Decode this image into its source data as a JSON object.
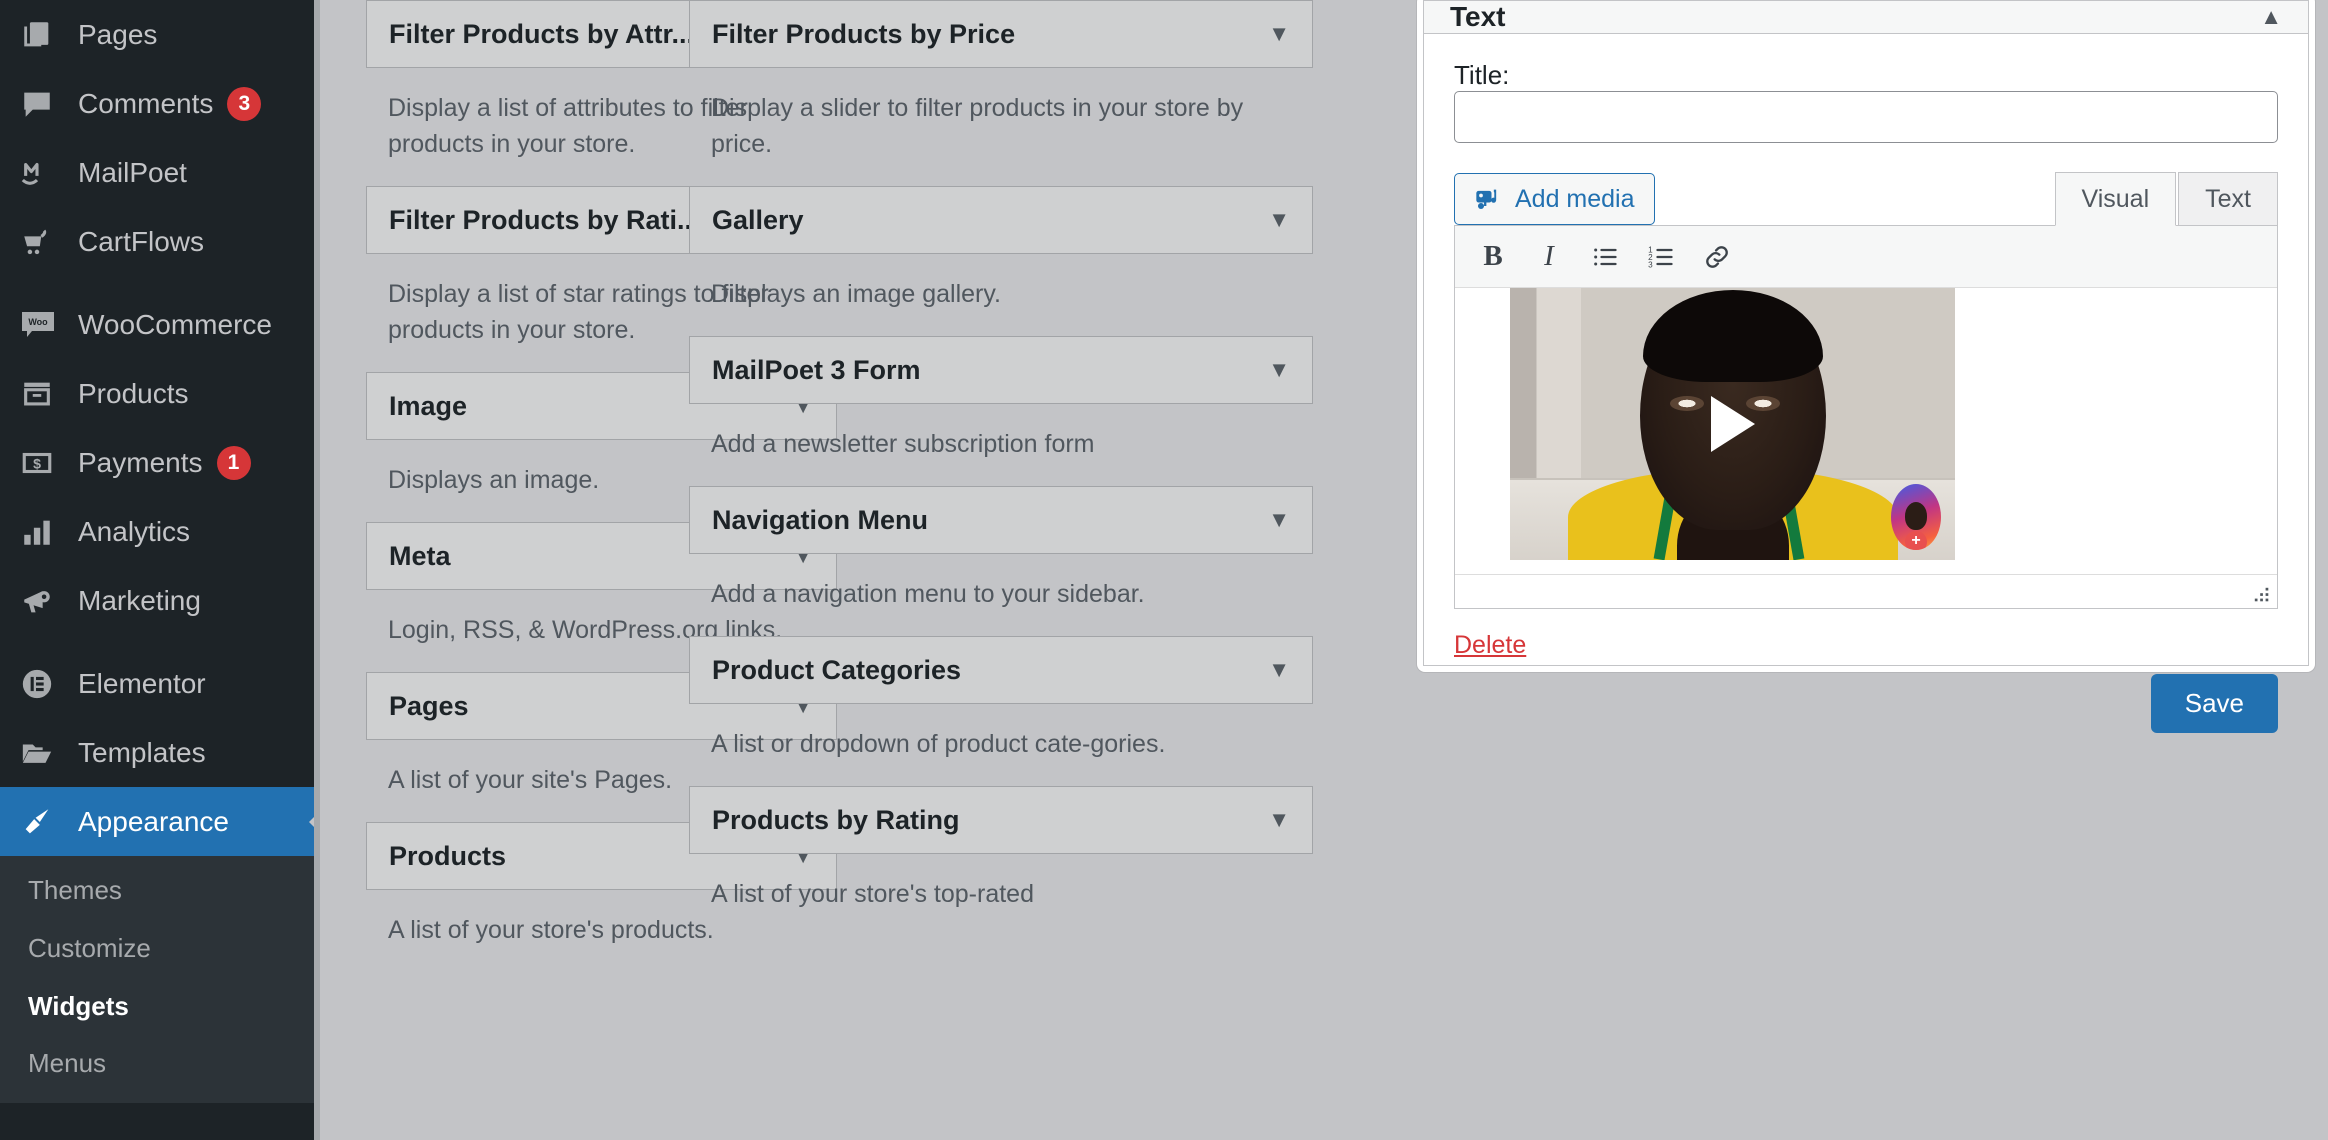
{
  "sidebar": {
    "items": [
      {
        "label": "Pages",
        "icon": "pages-icon",
        "badge": null
      },
      {
        "label": "Comments",
        "icon": "comments-icon",
        "badge": "3"
      },
      {
        "label": "MailPoet",
        "icon": "mailpoet-icon",
        "badge": null
      },
      {
        "label": "CartFlows",
        "icon": "cartflows-icon",
        "badge": null
      },
      {
        "label": "WooCommerce",
        "icon": "woocommerce-icon",
        "badge": null
      },
      {
        "label": "Products",
        "icon": "products-icon",
        "badge": null
      },
      {
        "label": "Payments",
        "icon": "payments-icon",
        "badge": "1"
      },
      {
        "label": "Analytics",
        "icon": "analytics-icon",
        "badge": null
      },
      {
        "label": "Marketing",
        "icon": "marketing-icon",
        "badge": null
      },
      {
        "label": "Elementor",
        "icon": "elementor-icon",
        "badge": null
      },
      {
        "label": "Templates",
        "icon": "templates-icon",
        "badge": null
      },
      {
        "label": "Appearance",
        "icon": "appearance-icon",
        "badge": null
      }
    ],
    "appearance_submenu": [
      {
        "label": "Themes",
        "current": false
      },
      {
        "label": "Customize",
        "current": false
      },
      {
        "label": "Widgets",
        "current": true
      },
      {
        "label": "Menus",
        "current": false
      }
    ],
    "active_item": "Appearance",
    "colors": {
      "background": "#1d2327",
      "submenu_background": "#2c3338",
      "active": "#2271b1",
      "badge": "#d63638"
    }
  },
  "widgets": {
    "left_column": [
      {
        "title": "Filter Products by Attr...",
        "description": "Display a list of attributes to filter products in your store."
      },
      {
        "title": "Filter Products by Rati...",
        "description": "Display a list of star ratings to filter products in your store."
      },
      {
        "title": "Image",
        "description": "Displays an image."
      },
      {
        "title": "Meta",
        "description": "Login, RSS, & WordPress.org links."
      },
      {
        "title": "Pages",
        "description": "A list of your site's Pages."
      },
      {
        "title": "Products",
        "description": "A list of your store's products."
      }
    ],
    "right_column": [
      {
        "title": "Filter Products by Price",
        "description": "Display a slider to filter products in your store by price."
      },
      {
        "title": "Gallery",
        "description": "Displays an image gallery."
      },
      {
        "title": "MailPoet 3 Form",
        "description": "Add a newsletter subscription form"
      },
      {
        "title": "Navigation Menu",
        "description": "Add a navigation menu to your sidebar."
      },
      {
        "title": "Product Categories",
        "description": "A list or dropdown of product cate-gories."
      },
      {
        "title": "Products by Rating",
        "description": "A list of your store's top-rated"
      }
    ],
    "caret": "▼"
  },
  "modal": {
    "header_title": "Text",
    "header_caret": "▲",
    "title_field_label": "Title:",
    "title_field_value": "",
    "title_field_placeholder": "",
    "add_media_label": "Add media",
    "tabs": [
      {
        "label": "Visual",
        "active": true
      },
      {
        "label": "Text",
        "active": false
      }
    ],
    "format_buttons": [
      {
        "name": "bold-icon",
        "glyph": "B"
      },
      {
        "name": "italic-icon",
        "glyph": "I"
      },
      {
        "name": "bulleted-list-icon",
        "glyph": ""
      },
      {
        "name": "numbered-list-icon",
        "glyph": ""
      },
      {
        "name": "link-icon",
        "glyph": ""
      }
    ],
    "delete_label": "Delete",
    "save_label": "Save",
    "colors": {
      "primary": "#2271b1",
      "danger": "#d63638",
      "header_bg": "#f6f7f7"
    }
  }
}
